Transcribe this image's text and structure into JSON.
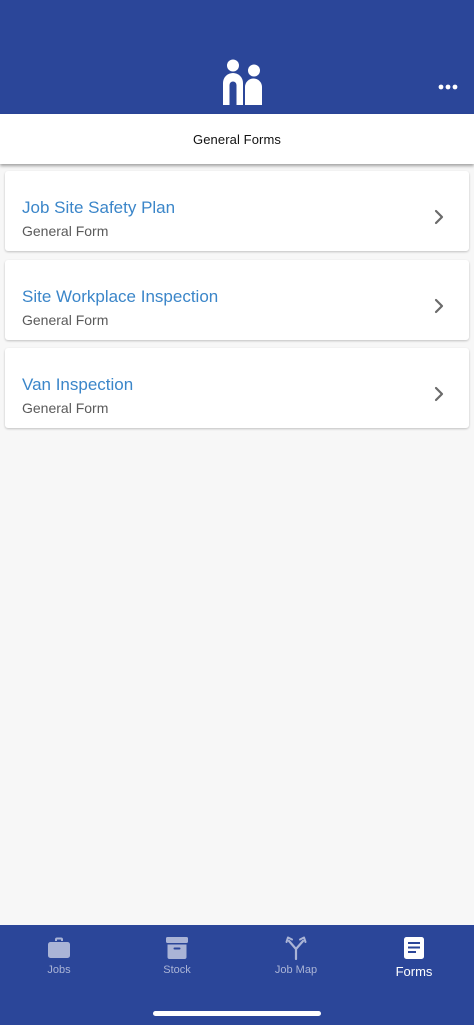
{
  "header": {
    "logo_icon": "people-logo-icon",
    "more_icon": "more-horizontal-icon",
    "background_color": "#2b4699"
  },
  "subheader": {
    "title": "General Forms"
  },
  "forms": [
    {
      "title": "Job Site Safety Plan",
      "subtitle": "General Form"
    },
    {
      "title": "Site Workplace Inspection",
      "subtitle": "General Form"
    },
    {
      "title": "Van Inspection",
      "subtitle": "General Form"
    }
  ],
  "tabbar": {
    "tabs": [
      {
        "label": "Jobs",
        "icon": "briefcase-icon",
        "active": false
      },
      {
        "label": "Stock",
        "icon": "archive-box-icon",
        "active": false
      },
      {
        "label": "Job Map",
        "icon": "route-fork-icon",
        "active": false
      },
      {
        "label": "Forms",
        "icon": "document-icon",
        "active": true
      }
    ]
  },
  "colors": {
    "accent_link": "#3b86c9",
    "tab_inactive": "#aab4d6",
    "tab_active": "#ffffff"
  }
}
